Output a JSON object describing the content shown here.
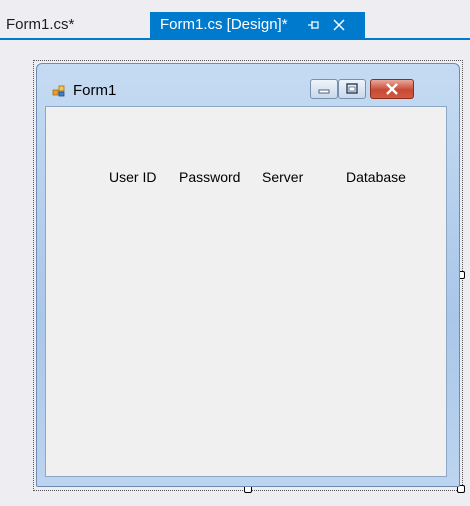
{
  "tabs": {
    "inactive_label": "Form1.cs*",
    "active_label": "Form1.cs [Design]*",
    "pin_icon": "pin-icon",
    "close_icon": "close-icon",
    "accent_color": "#007acc"
  },
  "form": {
    "title": "Form1",
    "icon": "form-icon",
    "buttons": [
      "minimize",
      "maximize",
      "close"
    ],
    "labels": {
      "user_id": "User ID",
      "password": "Password",
      "server": "Server",
      "database": "Database"
    }
  }
}
